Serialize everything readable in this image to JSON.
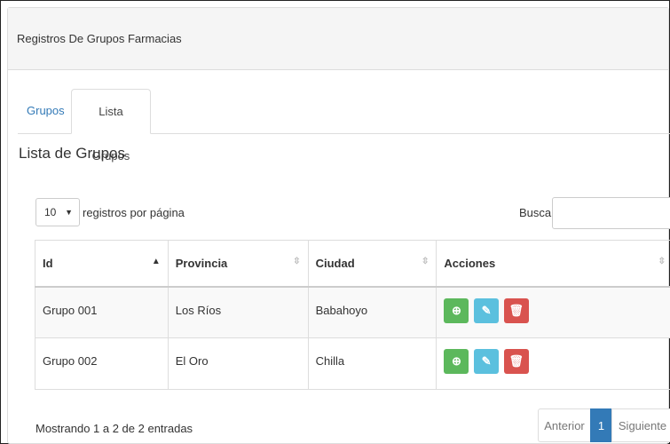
{
  "panel": {
    "title": "Registros De Grupos Farmacias"
  },
  "tabs": [
    {
      "label": "Grupos"
    },
    {
      "label": "Lista Grupos"
    }
  ],
  "section": {
    "title": "Lista de Grupos"
  },
  "length": {
    "value": "10",
    "label": "registros por página"
  },
  "search": {
    "label": "Buscar:",
    "value": ""
  },
  "table": {
    "columns": [
      "Id",
      "Provincia",
      "Ciudad",
      "Acciones"
    ],
    "rows": [
      {
        "id": "Grupo 001",
        "provincia": "Los Ríos",
        "ciudad": "Babahoyo"
      },
      {
        "id": "Grupo 002",
        "provincia": "El Oro",
        "ciudad": "Chilla"
      }
    ]
  },
  "footer": {
    "info": "Mostrando 1 a 2 de 2 entradas"
  },
  "pagination": {
    "prev": "Anterior",
    "current": "1",
    "next": "Siguiente"
  },
  "colors": {
    "view": "#5cb85c",
    "edit": "#5bc0de",
    "delete": "#d9534f",
    "active": "#337ab7"
  }
}
